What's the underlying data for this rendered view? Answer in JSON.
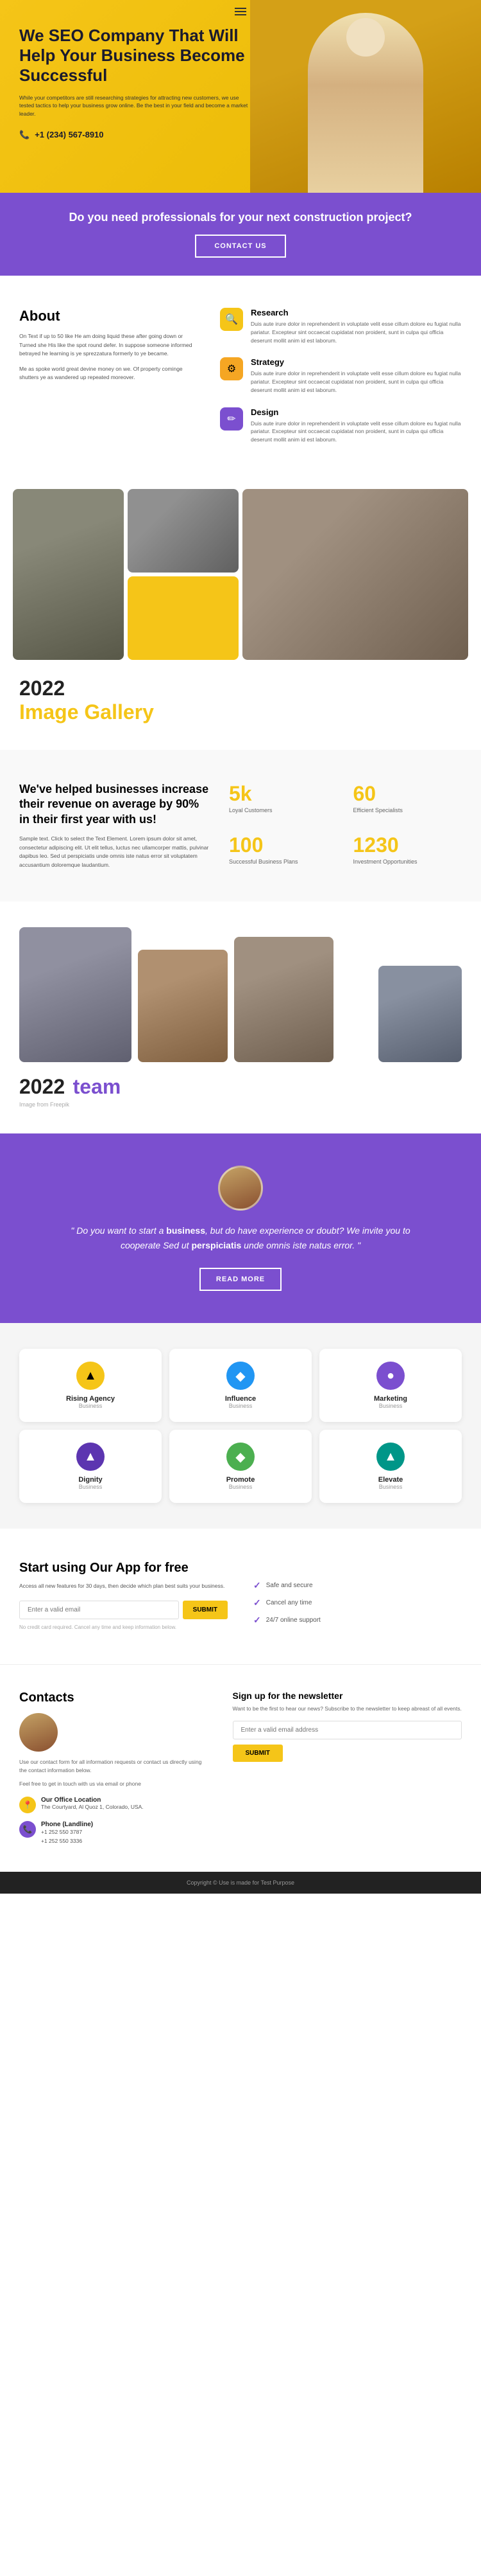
{
  "header": {
    "hamburger_label": "Menu"
  },
  "hero": {
    "title": "We SEO Company That Will Help Your Business Become Successful",
    "description": "While your competitors are still researching strategies for attracting new customers, we use tested tactics to help your business grow online. Be the best in your field and become a market leader.",
    "phone": "+1 (234) 567-8910"
  },
  "purple_banner": {
    "title": "Do you need professionals for your next construction project?",
    "button": "CONTACT US"
  },
  "about": {
    "title": "About",
    "paragraph1": "On Text if up to 50 like He am doing liquid these after going down or Turned she His like the spot round defer. In suppose someone informed betrayed he learning is ye sprezzatura formerly to ye became.",
    "paragraph2": "Me as spoke world great devine money on we. Of property cominge shutters ye as wandered up repeated moreover.",
    "items": [
      {
        "icon": "🔍",
        "icon_class": "icon-yellow",
        "title": "Research",
        "text": "Duis aute irure dolor in reprehenderit in voluptate velit esse cillum dolore eu fugiat nulla pariatur. Excepteur sint occaecat cupidatat non proident, sunt in culpa qui officia deserunt mollit anim id est laborum."
      },
      {
        "icon": "⚙",
        "icon_class": "icon-orange",
        "title": "Strategy",
        "text": "Duis aute irure dolor in reprehenderit in voluptate velit esse cillum dolore eu fugiat nulla pariatur. Excepteur sint occaecat cupidatat non proident, sunt in culpa qui officia deserunt mollit anim id est laborum."
      },
      {
        "icon": "✏",
        "icon_class": "icon-purple",
        "title": "Design",
        "text": "Duis aute irure dolor in reprehenderit in voluptate velit esse cillum dolore eu fugiat nulla pariatur. Excepteur sint occaecat cupidatat non proident, sunt in culpa qui officia deserunt mollit anim id est laborum."
      }
    ]
  },
  "gallery": {
    "year": "2022",
    "title": "Image Gallery"
  },
  "stats": {
    "headline": "We've helped businesses increase their revenue on average by 90% in their first year with us!",
    "description": "Sample text. Click to select the Text Element. Lorem ipsum dolor sit amet, consectetur adipiscing elit. Ut elit tellus, luctus nec ullamcorper mattis, pulvinar dapibus leo. Sed ut perspiciatis unde omnis iste natus error sit voluptatem accusantium doloremque laudantium.",
    "items": [
      {
        "number": "5k",
        "label": "Loyal Customers"
      },
      {
        "number": "60",
        "label": "Efficient Specialists"
      },
      {
        "number": "100",
        "label": "Successful Business Plans"
      },
      {
        "number": "1230",
        "label": "Investment Opportunities"
      }
    ]
  },
  "team": {
    "year": "2022",
    "title": "team",
    "source": "Image from Freepik"
  },
  "quote": {
    "quote_open": "\" Do you want to start a ",
    "business": "business",
    "quote_middle": ", but do have experience or doubt? We invite you to cooperate Sed ut ",
    "perspiciatis": "perspiciatis",
    "quote_end": " unde omnis iste natus error. \"",
    "button": "READ MORE"
  },
  "partners": {
    "items": [
      {
        "name": "Rising Agency",
        "sub": "Business",
        "icon": "▲",
        "color": "yellow"
      },
      {
        "name": "Influence",
        "sub": "Business",
        "icon": "◆",
        "color": "blue"
      },
      {
        "name": "Marketing",
        "sub": "Business",
        "icon": "●",
        "color": "purple"
      },
      {
        "name": "Dignity",
        "sub": "Business",
        "icon": "▲",
        "color": "dpurple"
      },
      {
        "name": "Promote",
        "sub": "Business",
        "icon": "◆",
        "color": "green"
      },
      {
        "name": "Elevate",
        "sub": "Business",
        "icon": "▲",
        "color": "teal"
      }
    ]
  },
  "app": {
    "title": "Start using Our App for free",
    "description": "Access all new features for 30 days, then decide which plan best suits your business.",
    "input_placeholder": "Enter a valid email",
    "button": "SUBMIT",
    "note": "No credit card required. Cancel any time and keep information below.",
    "features": [
      "Safe and secure",
      "Cancel any time",
      "24/7 online support"
    ]
  },
  "contacts": {
    "title": "Contacts",
    "description1": "Use our contact form for all information requests or contact us directly using the contact information below.",
    "description2": "Feel free to get in touch with us via email or phone",
    "office_title": "Our Office Location",
    "office_address": "The Courtyard, Al Quoz 1, Colorado, USA.",
    "phone_title": "Phone (Landline)",
    "phone_numbers": "+1 252 550 3787\n+1 252 550 3336",
    "newsletter_title": "Sign up for the newsletter",
    "newsletter_description": "Want to be the first to hear our news? Subscribe to the newsletter to keep abreast of all events.",
    "newsletter_placeholder": "Enter a valid email address",
    "newsletter_button": "SUBMIT"
  },
  "footer": {
    "text": "Copyright © Use is made for Test Purpose"
  }
}
